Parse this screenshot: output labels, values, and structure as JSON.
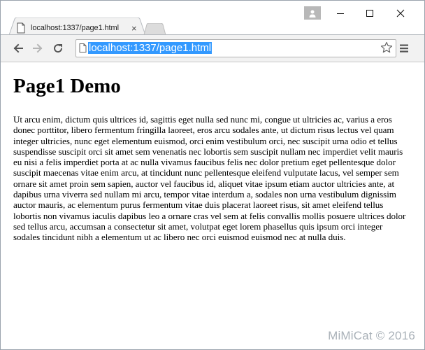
{
  "tab": {
    "title": "localhost:1337/page1.html",
    "close": "×"
  },
  "address_bar": {
    "url": "localhost:1337/page1.html"
  },
  "window_controls": {
    "minimize": "minimize-icon",
    "maximize": "maximize-icon",
    "close": "close-icon"
  },
  "icons": {
    "back": "back-arrow-icon",
    "forward": "forward-arrow-icon",
    "reload": "reload-icon",
    "star": "bookmark-star-icon",
    "menu": "hamburger-menu-icon",
    "user": "user-profile-icon",
    "page": "page-icon"
  },
  "page": {
    "heading": "Page1 Demo",
    "body": "Ut arcu enim, dictum quis ultrices id, sagittis eget nulla sed nunc mi, congue ut ultricies ac, varius a eros donec porttitor, libero fermentum fringilla laoreet, eros arcu sodales ante, ut dictum risus lectus vel quam integer ultricies, nunc eget elementum euismod, orci enim vestibulum orci, nec suscipit urna odio et tellus suspendisse suscipit orci sit amet sem venenatis nec lobortis sem suscipit nullam nec imperdiet velit mauris eu nisi a felis imperdiet porta at ac nulla vivamus faucibus felis nec dolor pretium eget pellentesque dolor suscipit maecenas vitae enim arcu, at tincidunt nunc pellentesque eleifend vulputate lacus, vel semper sem ornare sit amet proin sem sapien, auctor vel faucibus id, aliquet vitae ipsum etiam auctor ultricies ante, at dapibus urna viverra sed nullam mi arcu, tempor vitae interdum a, sodales non urna vestibulum dignissim auctor mauris, ac elementum purus fermentum vitae duis placerat laoreet risus, sit amet eleifend tellus lobortis non vivamus iaculis dapibus leo a ornare cras vel sem at felis convallis mollis posuere ultrices dolor sed tellus arcu, accumsan a consectetur sit amet, volutpat eget lorem phasellus quis ipsum orci integer sodales tincidunt nibh a elementum ut ac libero nec orci euismod euismod nec at nulla duis."
  },
  "watermark": "MiMiCat © 2016",
  "colors": {
    "selection": "#3399ff",
    "toolbar": "#f2f2f2",
    "watermark": "#a9b1b8"
  }
}
